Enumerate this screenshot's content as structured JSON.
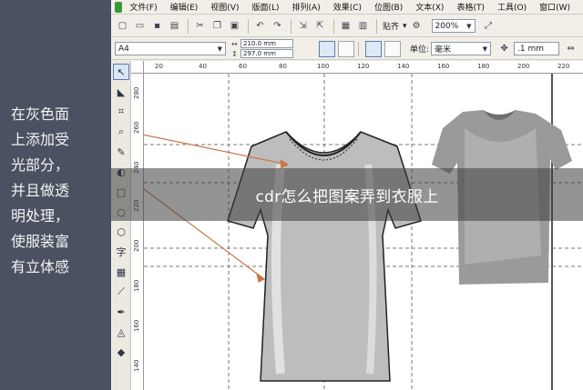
{
  "annotation": {
    "lines": [
      "在灰色面",
      "上添加受",
      "光部分，",
      "并且做透",
      "明处理，",
      "使服装富",
      "有立体感"
    ]
  },
  "banner": {
    "title": "cdr怎么把图案弄到衣服上"
  },
  "menubar": {
    "items": [
      "文件(F)",
      "编辑(E)",
      "视图(V)",
      "版面(L)",
      "排列(A)",
      "效果(C)",
      "位图(B)",
      "文本(X)",
      "表格(T)",
      "工具(O)",
      "窗口(W)"
    ]
  },
  "toolbar": {
    "paste_label": "贴齐",
    "zoom_value": "200%"
  },
  "propbar": {
    "page_size": "A4",
    "width_value": "210.0 mm",
    "height_value": "297.0 mm",
    "units_label": "单位:",
    "units_value": "毫米",
    "nudge_value": ".1 mm"
  },
  "ruler": {
    "top_ticks": [
      "20",
      "40",
      "60",
      "80",
      "100",
      "120",
      "140",
      "160",
      "180",
      "200",
      "220"
    ],
    "left_ticks": [
      "260",
      "240",
      "220",
      "200",
      "180",
      "160",
      "140"
    ],
    "left_top_label": "280"
  },
  "tools": [
    "pointer-icon",
    "shape-icon",
    "crop-icon",
    "zoom-icon",
    "freehand-icon",
    "smart-fill-icon",
    "rectangle-icon",
    "ellipse-icon",
    "polygon-icon",
    "text-icon",
    "table-icon",
    "connector-icon",
    "eyedropper-icon",
    "outline-icon",
    "fill-icon"
  ],
  "colors": {
    "panel_bg": "#4a5160",
    "arrow_color": "#c8784a",
    "shirt_gray": "#bdbdbd"
  }
}
